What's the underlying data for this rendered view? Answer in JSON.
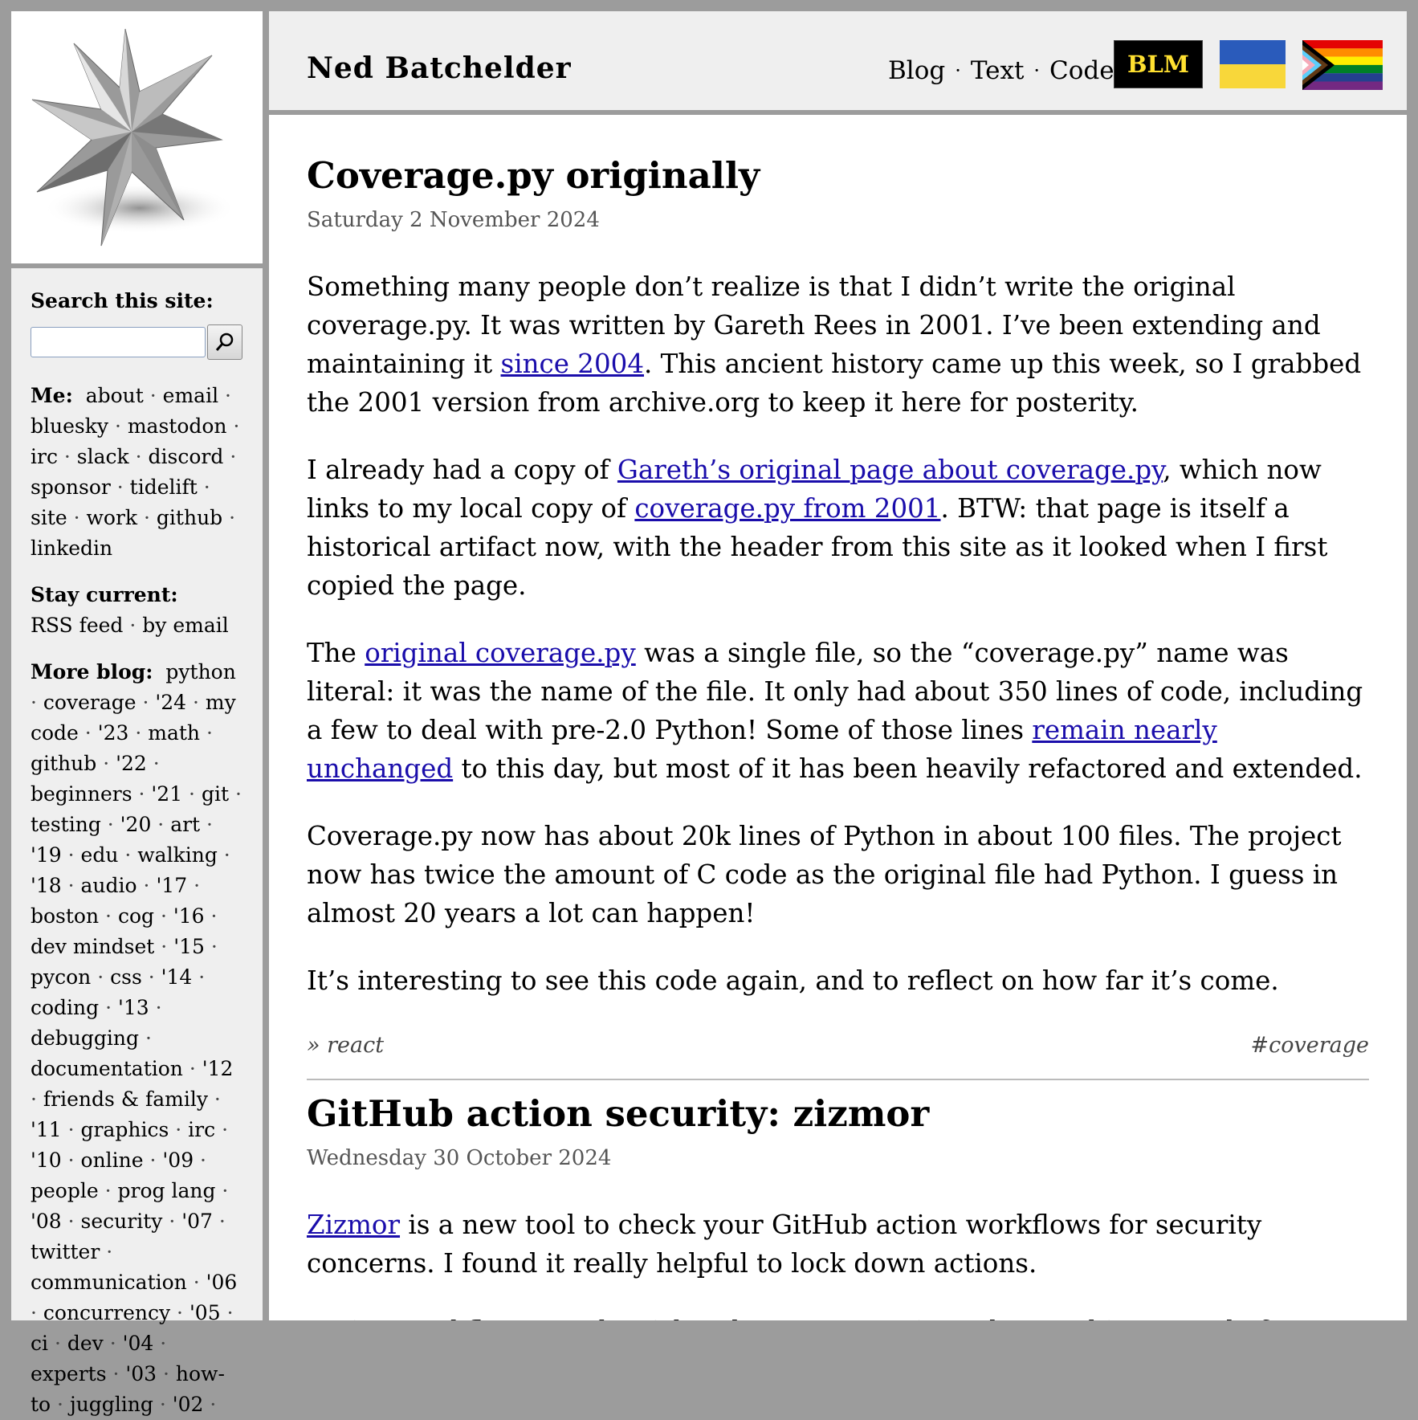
{
  "header": {
    "site_title": "Ned Batchelder",
    "nav": [
      "Blog",
      "Text",
      "Code"
    ],
    "nav_sep": "·",
    "blm_label": "BLM"
  },
  "sidebar": {
    "search_label": "Search this site:",
    "search_placeholder": "",
    "me_label": "Me:",
    "me_links": [
      "about",
      "email",
      "bluesky",
      "mastodon",
      "irc",
      "slack",
      "discord",
      "sponsor",
      "tidelift",
      "site",
      "work",
      "github",
      "linkedin"
    ],
    "stay_label": "Stay current:",
    "stay_links": [
      "RSS feed",
      "by email"
    ],
    "more_label": "More blog:",
    "more_links": [
      "python",
      "coverage",
      "'24",
      "my code",
      "'23",
      "math",
      "github",
      "'22",
      "beginners",
      "'21",
      "git",
      "testing",
      "'20",
      "art",
      "'19",
      "edu",
      "walking",
      "'18",
      "audio",
      "'17",
      "boston",
      "cog",
      "'16",
      "dev mindset",
      "'15",
      "pycon",
      "css",
      "'14",
      "coding",
      "'13",
      "debugging",
      "documentation",
      "'12",
      "friends & family",
      "'11",
      "graphics",
      "irc",
      "'10",
      "online",
      "'09",
      "people",
      "prog lang",
      "'08",
      "security",
      "'07",
      "twitter",
      "communication",
      "'06",
      "concurrency",
      "'05",
      "ci",
      "dev",
      "'04",
      "experts",
      "'03",
      "how-to",
      "juggling",
      "'02"
    ]
  },
  "posts": [
    {
      "title": "Coverage.py originally",
      "date": "Saturday 2 November 2024",
      "p1": {
        "a": "Something many people don’t realize is that I didn’t write the original coverage.py. It was written by Gareth Rees in 2001. I’ve been extending and maintaining it ",
        "link": "since 2004",
        "b": ". This ancient history came up this week, so I grabbed the 2001 version from archive.org to keep it here for posterity."
      },
      "p2": {
        "a": "I already had a copy of ",
        "link1": "Gareth’s original page about coverage.py",
        "b": ", which now links to my local copy of ",
        "link2": "coverage.py from 2001",
        "c": ". BTW: that page is itself a historical artifact now, with the header from this site as it looked when I first copied the page."
      },
      "p3": {
        "a": "The ",
        "link1": "original coverage.py",
        "b": " was a single file, so the “coverage.py” name was literal: it was the name of the file. It only had about 350 lines of code, including a few to deal with pre-2.0 Python! Some of those lines ",
        "link2": "remain nearly unchanged",
        "c": " to this day, but most of it has been heavily refactored and extended."
      },
      "p4": "Coverage.py now has about 20k lines of Python in about 100 files. The project now has twice the amount of C code as the original file had Python. I guess in almost 20 years a lot can happen!",
      "p5": "It’s interesting to see this code again, and to reflect on how far it’s come.",
      "react": "» react",
      "tag": "#coverage"
    },
    {
      "title": "GitHub action security: zizmor",
      "date": "Wednesday 30 October 2024",
      "p1": {
        "link": "Zizmor",
        "a": " is a new tool to check your GitHub action workflows for security concerns. I found it really helpful to lock down actions."
      },
      "p2": "Action workflows can be risky: they can contain and run arbitrary code from ..."
    }
  ],
  "colors": {
    "page_bg": "#9c9c9c",
    "panel_bg": "#efefef",
    "link": "#1a0dab",
    "blm_bg": "#000000",
    "blm_text": "#ffe030",
    "ua_blue": "#2a5bbb",
    "ua_yellow": "#f8d73a"
  }
}
